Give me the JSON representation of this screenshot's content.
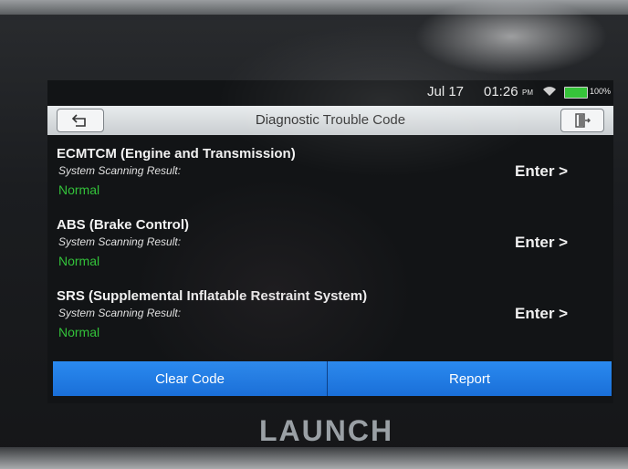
{
  "status_bar": {
    "date": "Jul 17",
    "time": "01:26",
    "am_pm": "PM",
    "battery": "100%"
  },
  "header": {
    "title": "Diagnostic Trouble Code",
    "back_icon": "back-arrow-icon",
    "exit_icon": "exit-icon"
  },
  "systems": [
    {
      "name": "ECMTCM (Engine and Transmission)",
      "subtitle": "System Scanning Result:",
      "result": "Normal",
      "enter_label": "Enter >"
    },
    {
      "name": "ABS (Brake Control)",
      "subtitle": "System Scanning Result:",
      "result": "Normal",
      "enter_label": "Enter >"
    },
    {
      "name": "SRS (Supplemental Inflatable Restraint System)",
      "subtitle": "System Scanning Result:",
      "result": "Normal",
      "enter_label": "Enter >"
    }
  ],
  "actions": {
    "clear_code": "Clear Code",
    "report": "Report"
  },
  "brand": "LAUNCH",
  "colors": {
    "accent": "#1f7be4",
    "normal_status": "#33c23a",
    "battery": "#36c43a"
  }
}
